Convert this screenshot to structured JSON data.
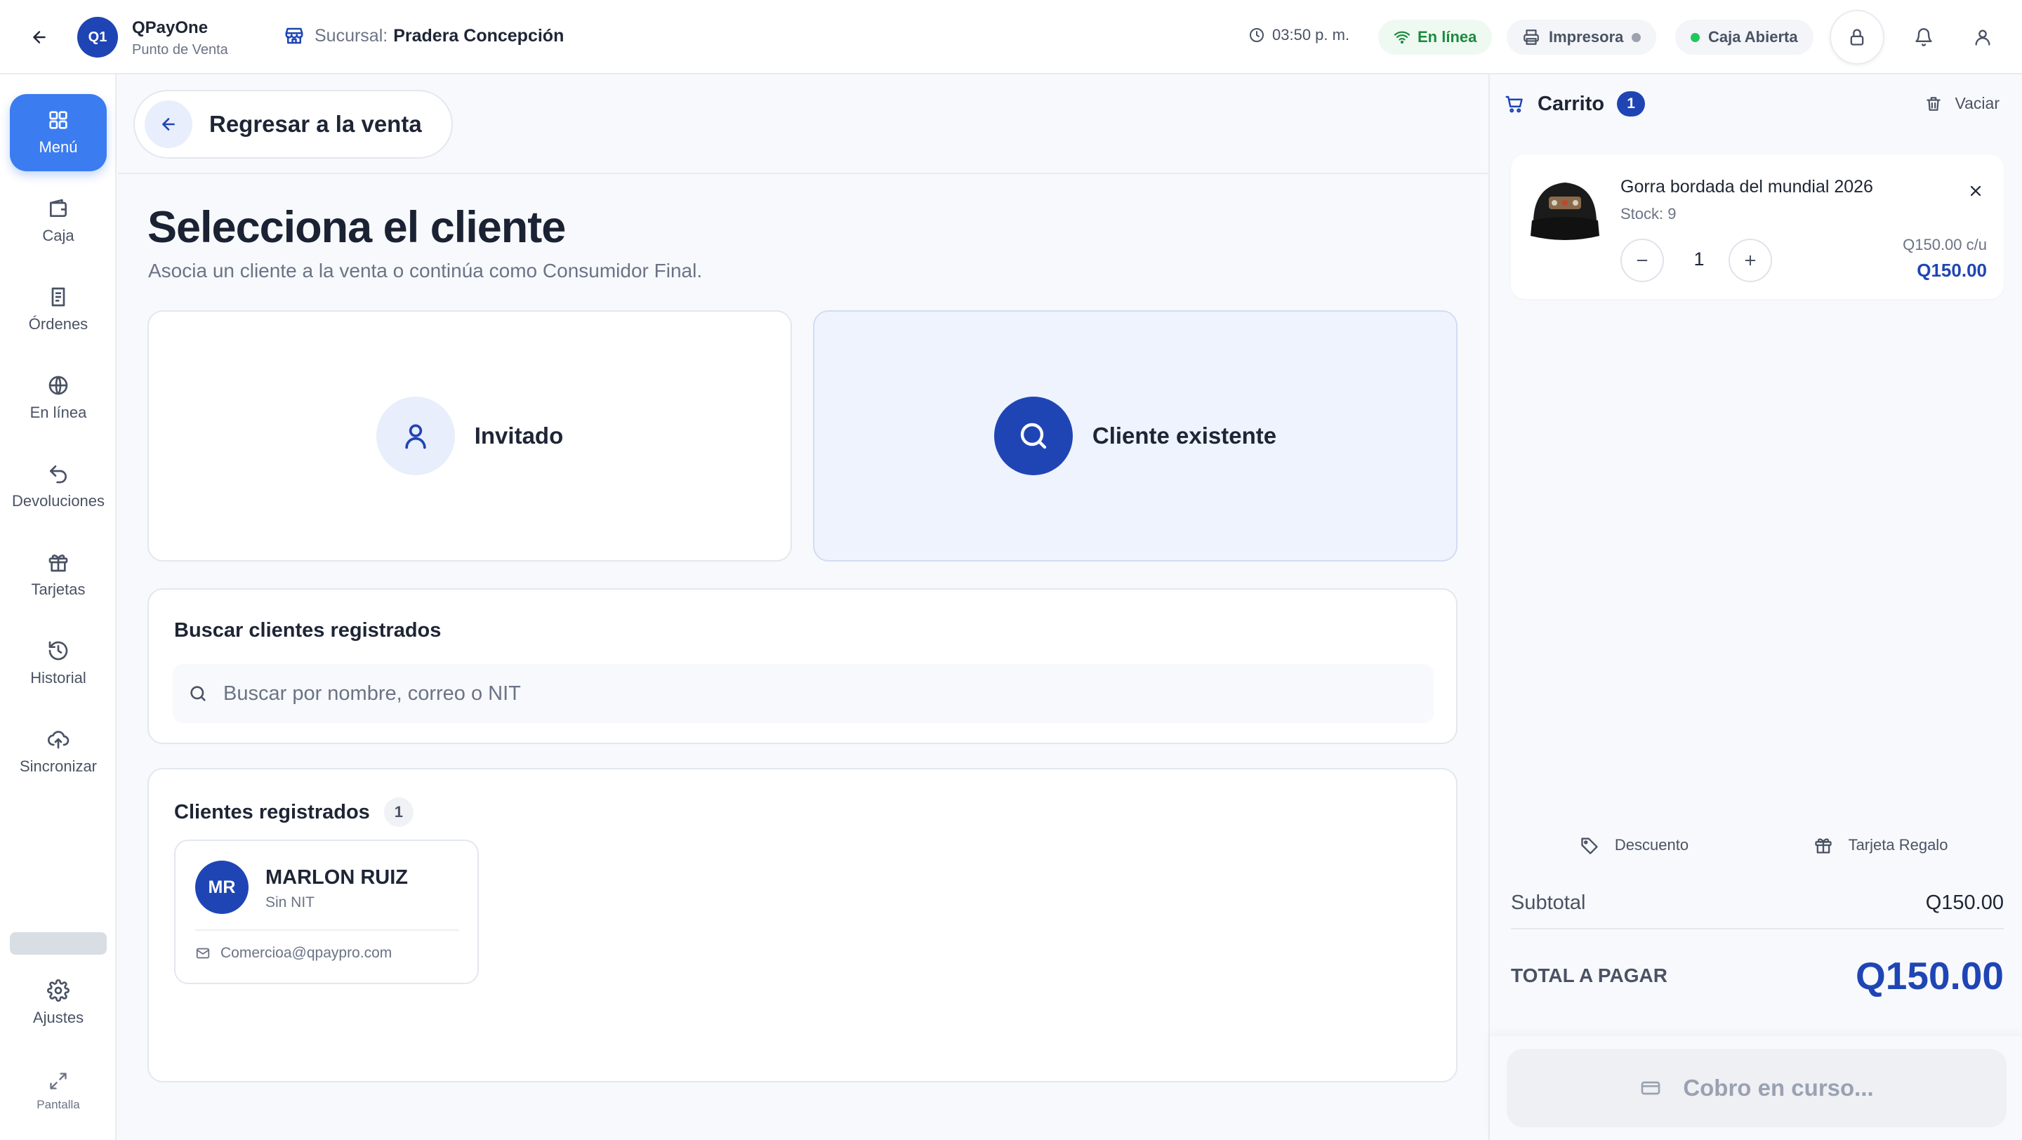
{
  "app": {
    "logo_text": "Q1",
    "name": "QPayOne",
    "subtitle": "Punto de Venta"
  },
  "topbar": {
    "branch_label": "Sucursal:",
    "branch_value": "Pradera Concepción",
    "time": "03:50 p. m.",
    "online_label": "En línea",
    "printer_label": "Impresora",
    "cash_label": "Caja Abierta",
    "colors": {
      "online": "#1c8a3e",
      "printer_dot": "#9ca3af",
      "cash_dot": "#22c55e"
    }
  },
  "sidebar": {
    "items": [
      {
        "label": "Menú",
        "icon": "grid-icon",
        "active": true
      },
      {
        "label": "Caja",
        "icon": "wallet-icon"
      },
      {
        "label": "Órdenes",
        "icon": "receipt-icon"
      },
      {
        "label": "En línea",
        "icon": "globe-icon"
      },
      {
        "label": "Devoluciones",
        "icon": "undo-icon"
      },
      {
        "label": "Tarjetas",
        "icon": "gift-icon"
      },
      {
        "label": "Historial",
        "icon": "history-icon"
      },
      {
        "label": "Sincronizar",
        "icon": "cloud-upload-icon"
      }
    ],
    "settings_label": "Ajustes",
    "screen_label": "Pantalla"
  },
  "main": {
    "back_label": "Regresar a la venta",
    "title": "Selecciona el cliente",
    "subtitle": "Asocia un cliente a la venta o continúa como Consumidor Final.",
    "options": {
      "guest": "Invitado",
      "existing": "Cliente existente"
    },
    "search": {
      "title": "Buscar clientes registrados",
      "placeholder": "Buscar por nombre, correo o NIT"
    },
    "clients": {
      "title": "Clientes registrados",
      "count": "1",
      "items": [
        {
          "initials": "MR",
          "name": "MARLON RUIZ",
          "nit": "Sin NIT",
          "email": "Comercioa@qpaypro.com"
        }
      ]
    }
  },
  "cart": {
    "title": "Carrito",
    "count": "1",
    "clear_label": "Vaciar",
    "items": [
      {
        "name": "Gorra bordada del mundial 2026",
        "stock": "Stock: 9",
        "quantity": "1",
        "unit_price": "Q150.00 c/u",
        "line_total": "Q150.00"
      }
    ],
    "discount_label": "Descuento",
    "giftcard_label": "Tarjeta Regalo",
    "subtotal_label": "Subtotal",
    "subtotal_value": "Q150.00",
    "total_label": "TOTAL A PAGAR",
    "total_value": "Q150.00",
    "pay_label": "Cobro en curso..."
  },
  "colors": {
    "accent": "#1f45b5",
    "active_nav": "#3b7cf0"
  }
}
